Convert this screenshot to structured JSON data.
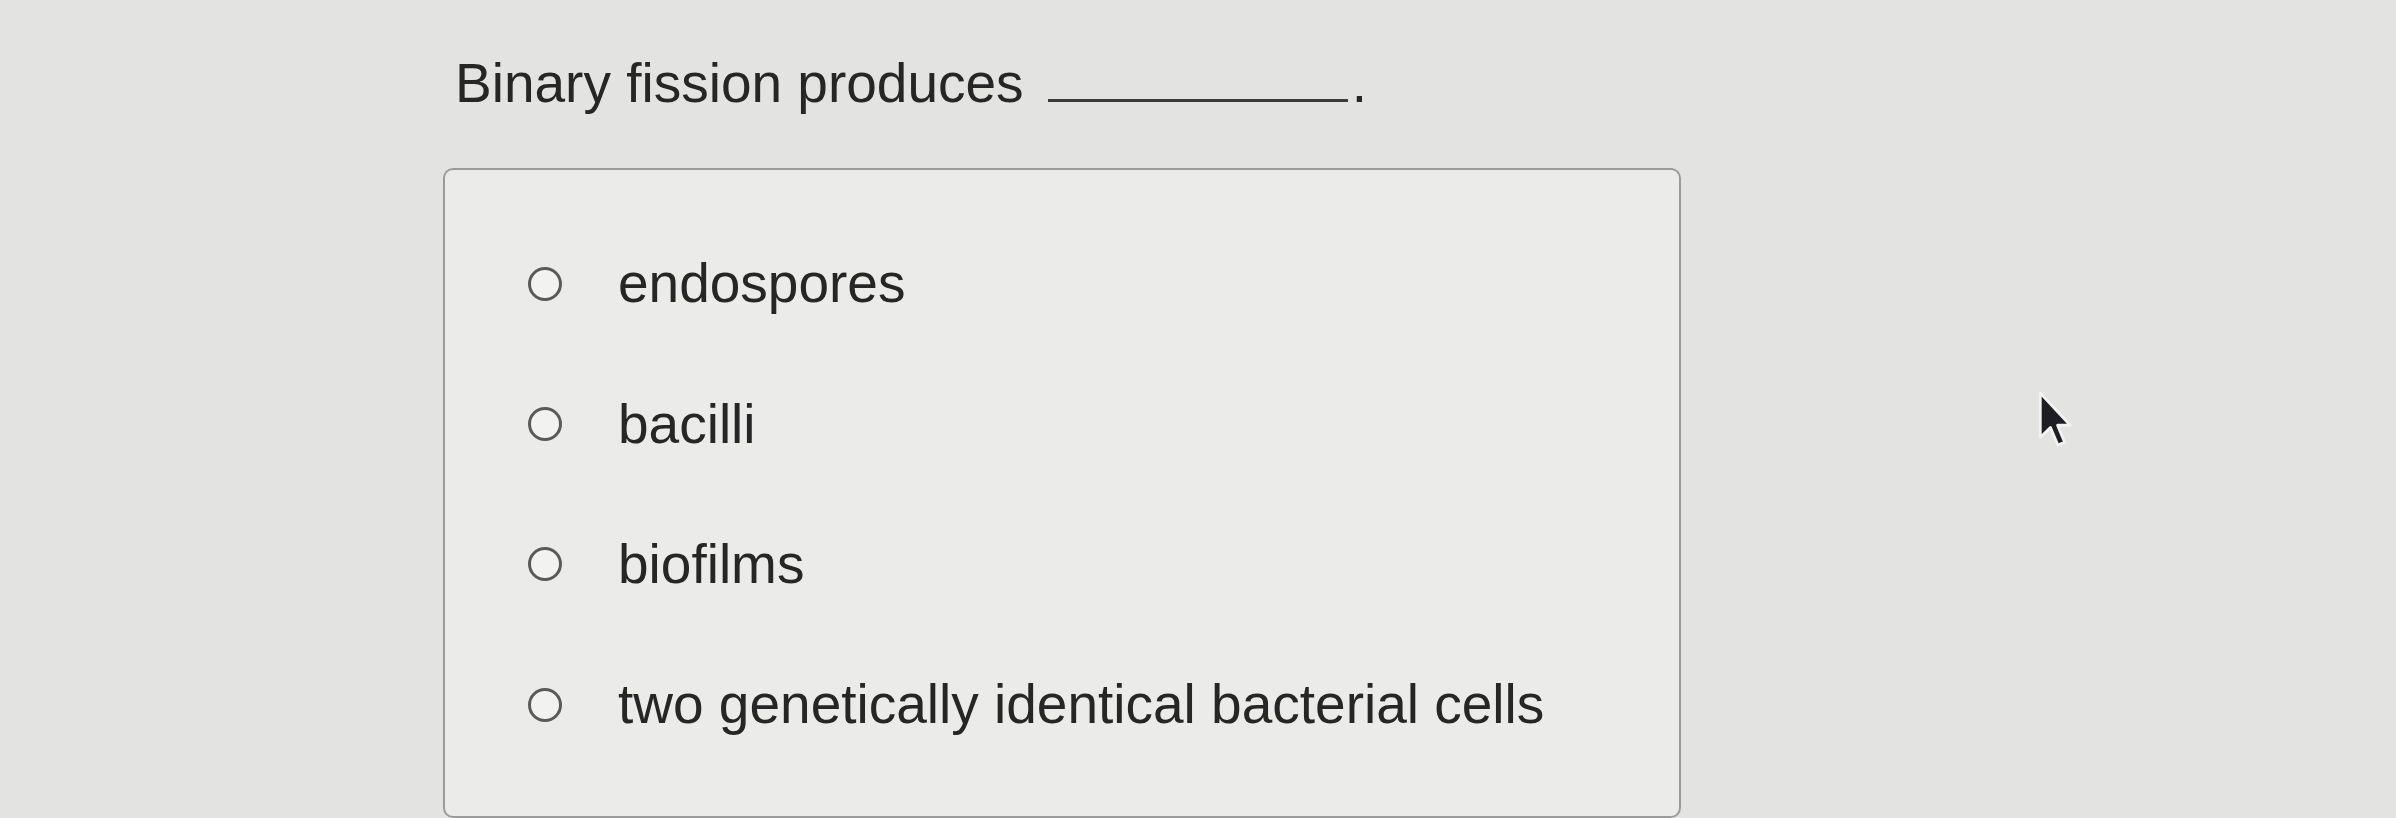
{
  "question": {
    "text": "Binary fission produces",
    "ending": "."
  },
  "options": [
    {
      "label": "endospores",
      "selected": false
    },
    {
      "label": "bacilli",
      "selected": false
    },
    {
      "label": "biofilms",
      "selected": false
    },
    {
      "label": "two genetically identical bacterial cells",
      "selected": false
    }
  ]
}
